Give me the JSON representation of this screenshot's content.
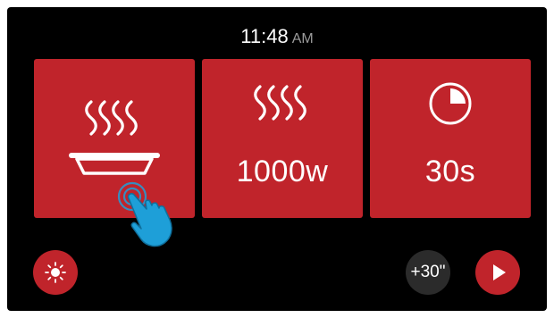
{
  "clock": {
    "time": "11:48",
    "period": "AM"
  },
  "tiles": [
    {
      "name": "cooking-mode",
      "icon": "steaming-dish-icon",
      "value": ""
    },
    {
      "name": "power",
      "icon": "heat-waves-icon",
      "value": "1000w"
    },
    {
      "name": "cook-time",
      "icon": "timer-clock-icon",
      "value": "30s"
    }
  ],
  "controls": {
    "light_icon": "sun-icon",
    "add_time_label": "+30\"",
    "start_icon": "play-icon"
  },
  "colors": {
    "background": "#000000",
    "accent_red": "#c0242b",
    "secondary_button": "#2b2b2b",
    "pointer_blue": "#1e9fd8"
  }
}
